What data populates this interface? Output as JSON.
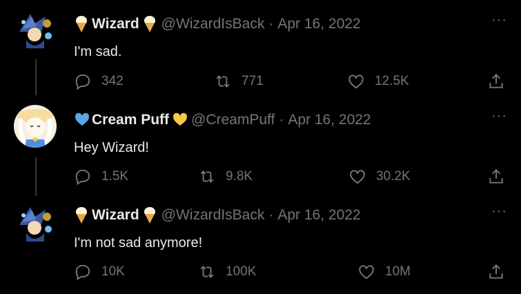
{
  "tweets": [
    {
      "name": "Wizard",
      "handle": "@WizardIsBack",
      "separator": "·",
      "date": "Apr 16, 2022",
      "text": "I'm sad.",
      "replies": "342",
      "retweets": "771",
      "likes": "12.5K",
      "badge_left": "ice-cream-icon",
      "badge_right": "ice-cream-icon"
    },
    {
      "name": "Cream Puff",
      "handle": "@CreamPuff",
      "separator": "·",
      "date": "Apr 16, 2022",
      "text": "Hey Wizard!",
      "replies": "1.5K",
      "retweets": "9.8K",
      "likes": "30.2K",
      "badge_left": "blue-heart-icon",
      "badge_right": "yellow-heart-icon"
    },
    {
      "name": "Wizard",
      "handle": "@WizardIsBack",
      "separator": "·",
      "date": "Apr 16, 2022",
      "text": "I'm not sad anymore!",
      "replies": "10K",
      "retweets": "100K",
      "likes": "10M",
      "badge_left": "ice-cream-icon",
      "badge_right": "ice-cream-icon"
    }
  ],
  "more_label": "···",
  "colors": {
    "background": "#000000",
    "text_primary": "#e7e9ea",
    "text_secondary": "#71767b",
    "thread_line": "#333639",
    "blue_heart": "#5ba4e6",
    "yellow_heart": "#f7c948"
  }
}
